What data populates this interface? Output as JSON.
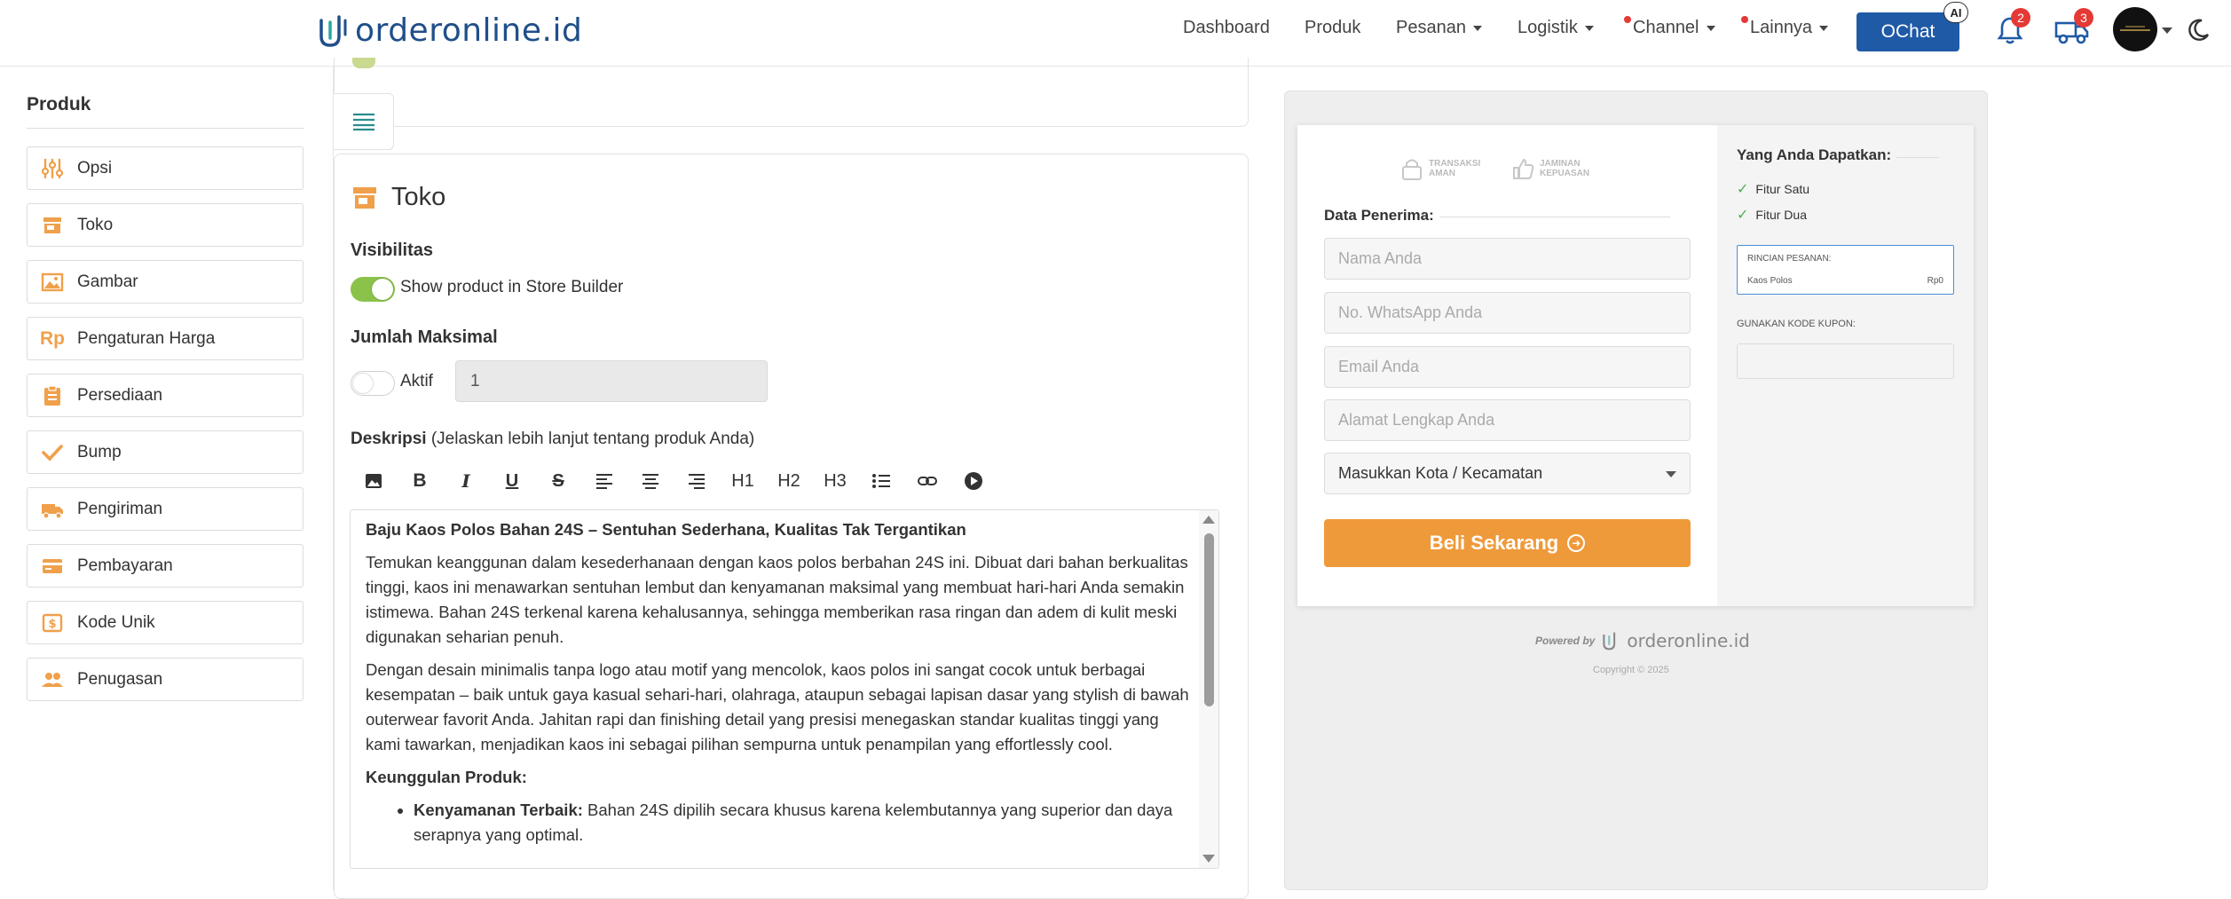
{
  "header": {
    "logo_text": "orderonline.id",
    "nav": [
      {
        "label": "Dashboard",
        "caret": false
      },
      {
        "label": "Produk",
        "caret": false
      },
      {
        "label": "Pesanan",
        "caret": true
      },
      {
        "label": "Logistik",
        "caret": true
      },
      {
        "label": "Channel",
        "caret": true
      },
      {
        "label": "Lainnya",
        "caret": true
      }
    ],
    "ochat_label": "OChat",
    "ai_badge": "AI",
    "notif_count": "2",
    "shipping_count": "3"
  },
  "sidebar": {
    "title": "Produk",
    "items": [
      {
        "label": "Opsi",
        "icon": "sliders-icon"
      },
      {
        "label": "Toko",
        "icon": "store-icon"
      },
      {
        "label": "Gambar",
        "icon": "image-icon"
      },
      {
        "label": "Pengaturan Harga",
        "icon": "rp-icon"
      },
      {
        "label": "Persediaan",
        "icon": "clipboard-icon"
      },
      {
        "label": "Bump",
        "icon": "check-icon"
      },
      {
        "label": "Pengiriman",
        "icon": "truck-icon"
      },
      {
        "label": "Pembayaran",
        "icon": "credit-card-icon"
      },
      {
        "label": "Kode Unik",
        "icon": "dollar-tag-icon"
      },
      {
        "label": "Penugasan",
        "icon": "people-icon"
      }
    ]
  },
  "main": {
    "section_title": "Toko",
    "visibility_label": "Visibilitas",
    "visibility_toggle_text": "Show product in Store Builder",
    "max_label": "Jumlah Maksimal",
    "max_toggle_text": "Aktif",
    "max_value": "1",
    "desc_label": "Deskripsi",
    "desc_hint": "(Jelaskan lebih lanjut tentang produk Anda)",
    "toolbar": [
      "H1",
      "H2",
      "H3"
    ],
    "editor": {
      "heading": "Baju Kaos Polos Bahan 24S – Sentuhan Sederhana, Kualitas Tak Tergantikan",
      "p1": "Temukan keanggunan dalam kesederhanaan dengan kaos polos berbahan 24S ini. Dibuat dari bahan berkualitas tinggi, kaos ini menawarkan sentuhan lembut dan kenyamanan maksimal yang membuat hari-hari Anda semakin istimewa. Bahan 24S terkenal karena kehalusannya, sehingga memberikan rasa ringan dan adem di kulit meski digunakan seharian penuh.",
      "p2": "Dengan desain minimalis tanpa logo atau motif yang mencolok, kaos polos ini sangat cocok untuk berbagai kesempatan – baik untuk gaya kasual sehari-hari, olahraga, ataupun sebagai lapisan dasar yang stylish di bawah outerwear favorit Anda. Jahitan rapi dan finishing detail yang presisi menegaskan standar kualitas tinggi yang kami tawarkan, menjadikan kaos ini sebagai pilihan sempurna untuk penampilan yang effortlessly cool.",
      "sub": "Keunggulan Produk:",
      "bullet_b": "Kenyamanan Terbaik:",
      "bullet_t": "Bahan 24S dipilih secara khusus karena kelembutannya yang superior dan daya serapnya yang optimal."
    }
  },
  "preview": {
    "trust1": "TRANSAKSI\nAMAN",
    "trust2": "JAMINAN\nKEPUASAN",
    "recipient_label": "Data Penerima:",
    "placeholders": {
      "name": "Nama Anda",
      "whatsapp": "No. WhatsApp Anda",
      "email": "Email Anda",
      "address": "Alamat Lengkap Anda"
    },
    "city_select": "Masukkan Kota / Kecamatan",
    "buy_label": "Beli Sekarang",
    "benefits_title": "Yang Anda Dapatkan:",
    "features": [
      "Fitur Satu",
      "Fitur Dua"
    ],
    "order_title": "RINCIAN PESANAN:",
    "order_item": "Kaos Polos",
    "order_price": "Rp0",
    "coupon_label": "GUNAKAN KODE KUPON:",
    "powered_by": "Powered by",
    "powered_logo": "orderonline.id",
    "copyright": "Copyright © 2025"
  },
  "colors": {
    "accent_orange": "#ef9a3a",
    "brand_blue": "#1f5aa6",
    "toggle_green": "#8bc34a",
    "badge_red": "#e53935"
  }
}
